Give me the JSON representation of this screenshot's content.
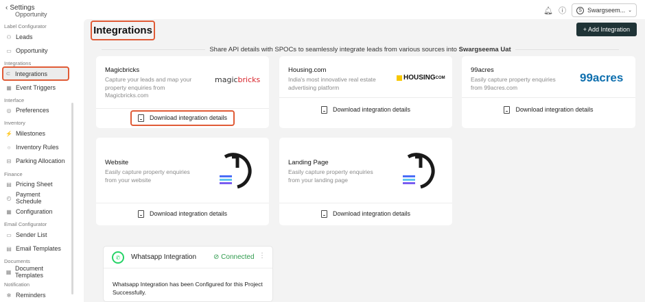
{
  "sidebar": {
    "back_label": "Settings",
    "cut_item": "Opportunity",
    "sections": [
      {
        "title": "Label Configurator",
        "items": [
          {
            "label": "Leads",
            "icon": "people-icon"
          },
          {
            "label": "Opportunity",
            "icon": "briefcase-icon"
          }
        ]
      },
      {
        "title": "Integrations",
        "items": [
          {
            "label": "Integrations",
            "icon": "link-icon"
          },
          {
            "label": "Event Triggers",
            "icon": "calendar-icon"
          }
        ]
      },
      {
        "title": "Interface",
        "items": [
          {
            "label": "Preferences",
            "icon": "sliders-icon"
          }
        ]
      },
      {
        "title": "Inventory",
        "items": [
          {
            "label": "Milestones",
            "icon": "milestone-icon"
          },
          {
            "label": "Inventory Rules",
            "icon": "circle-icon"
          },
          {
            "label": "Parking Allocation",
            "icon": "car-icon"
          }
        ]
      },
      {
        "title": "Finance",
        "items": [
          {
            "label": "Pricing Sheet",
            "icon": "sheet-icon"
          },
          {
            "label": "Payment Schedule",
            "icon": "clock-icon"
          },
          {
            "label": "Configuration",
            "icon": "grid-icon"
          }
        ]
      },
      {
        "title": "Email Configurator",
        "items": [
          {
            "label": "Sender List",
            "icon": "list-icon"
          },
          {
            "label": "Email Templates",
            "icon": "template-icon"
          }
        ]
      },
      {
        "title": "Documents",
        "items": [
          {
            "label": "Document Templates",
            "icon": "document-icon"
          }
        ]
      },
      {
        "title": "Notification",
        "items": [
          {
            "label": "Reminders",
            "icon": "bell-icon"
          }
        ]
      }
    ]
  },
  "header": {
    "user_label": "Swargseem...",
    "title": "Integrations",
    "add_button": "+ Add Integration",
    "banner_prefix": "Share API details with SPOCs to seamlessly integrate leads from various sources into ",
    "banner_project": "Swargseema Uat"
  },
  "cards": {
    "magicbricks": {
      "name": "Magicbricks",
      "desc": "Capture your leads and map your property enquiries from Magicbricks.com",
      "logo_a": "magic",
      "logo_b": "bricks"
    },
    "housing": {
      "name": "Housing.com",
      "desc": "India's most innovative real estate advertising platform",
      "logo": "HOUSING",
      "logo_suffix": "COM"
    },
    "acres": {
      "name": "99acres",
      "desc": "Easily capture property enquiries from 99acres.com",
      "logo": "99acres"
    },
    "website": {
      "name": "Website",
      "desc": "Easily capture property enquiries from your website"
    },
    "landing": {
      "name": "Landing Page",
      "desc": "Easily capture property enquiries from your landing page"
    },
    "download_label": "Download integration details"
  },
  "whatsapp": {
    "title": "Whatsapp Integration",
    "status": "Connected",
    "body": "Whatsapp Integration has been Configured for this Project Successfully."
  },
  "colors": {
    "accent_highlight": "#e05a35",
    "primary_button": "#1f3336",
    "connected": "#2e9a4c"
  }
}
